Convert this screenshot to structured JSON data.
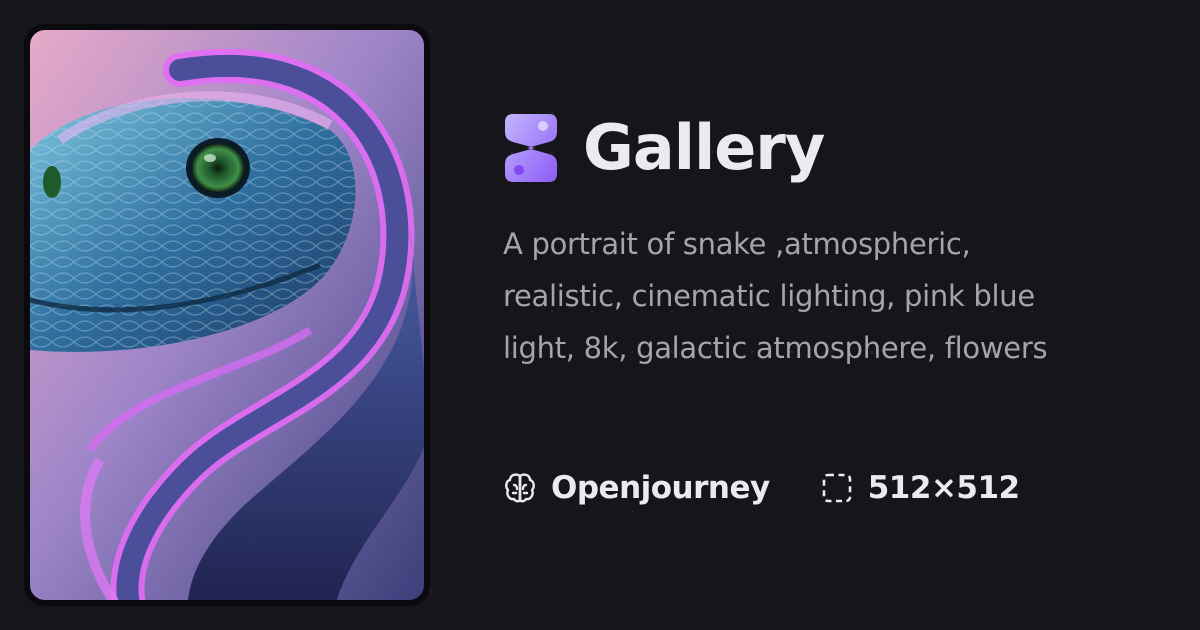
{
  "app": {
    "title": "Gallery",
    "logo_icon": "gallery-logo-icon",
    "accent_color": "#a78bfa"
  },
  "image": {
    "subject_icon": "snake-artwork"
  },
  "prompt": {
    "text": "A portrait of snake ,atmospheric, realistic, cinematic lighting, pink blue light, 8k, galactic atmosphere, flowers"
  },
  "meta": {
    "model": {
      "icon": "brain-icon",
      "label": "Openjourney"
    },
    "dimensions": {
      "icon": "dashed-square-icon",
      "label": "512×512"
    }
  }
}
